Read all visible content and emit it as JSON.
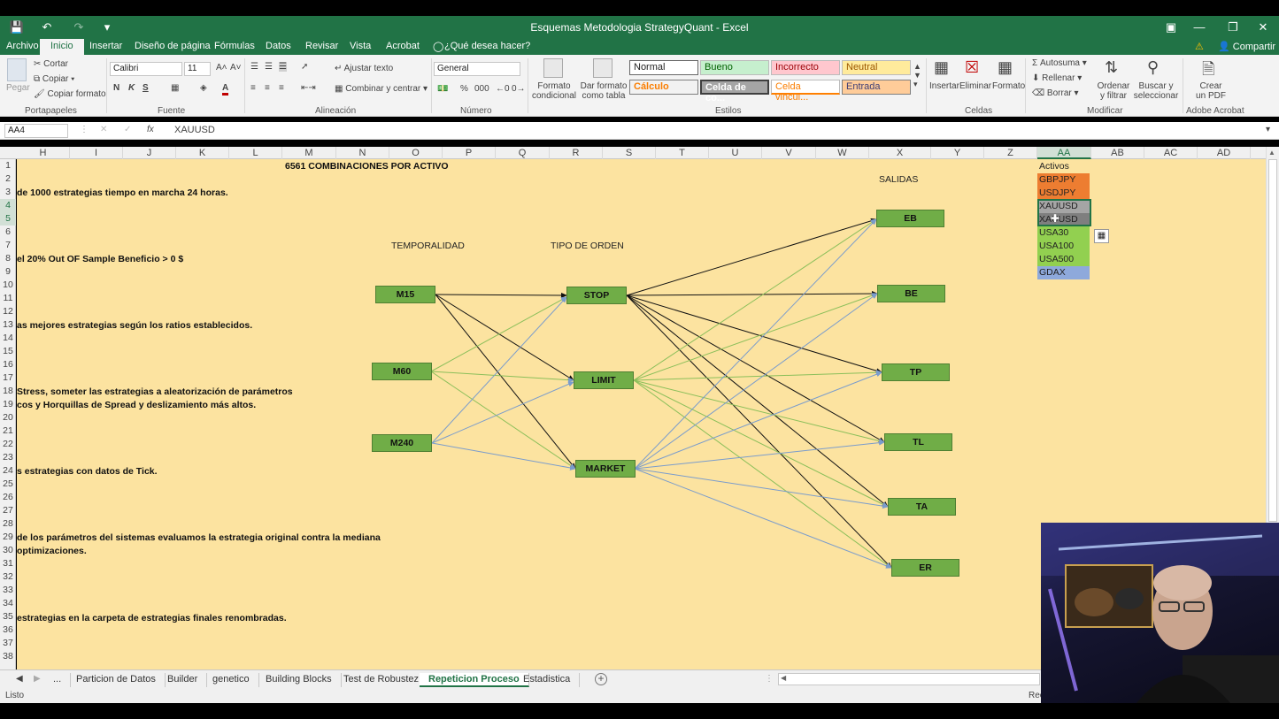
{
  "window": {
    "title": "Esquemas Metodologia StrategyQuant - Excel"
  },
  "ribbon_tabs": [
    "Archivo",
    "Inicio",
    "Insertar",
    "Diseño de página",
    "Fórmulas",
    "Datos",
    "Revisar",
    "Vista",
    "Acrobat"
  ],
  "tell_me": "¿Qué desea hacer?",
  "share_label": "Compartir",
  "clipboard": {
    "paste": "Pegar",
    "cut": "Cortar",
    "copy": "Copiar",
    "format_painter": "Copiar formato",
    "group": "Portapapeles"
  },
  "font": {
    "name": "Calibri",
    "size": "11",
    "group": "Fuente"
  },
  "alignment": {
    "wrap": "Ajustar texto",
    "merge": "Combinar y centrar",
    "group": "Alineación"
  },
  "number": {
    "format": "General",
    "group": "Número"
  },
  "styles": {
    "conditional": "Formato condicional",
    "as_table": "Dar formato como tabla",
    "items": [
      "Normal",
      "Bueno",
      "Incorrecto",
      "Neutral",
      "Cálculo",
      "Celda de co...",
      "Celda vincul...",
      "Entrada"
    ],
    "group": "Estilos"
  },
  "cells": {
    "insert": "Insertar",
    "delete": "Eliminar",
    "format": "Formato",
    "group": "Celdas"
  },
  "editing": {
    "autosum": "Autosuma",
    "fill": "Rellenar",
    "clear": "Borrar",
    "sort": "Ordenar y filtrar",
    "find": "Buscar y seleccionar",
    "group": "Modificar"
  },
  "acrobat": {
    "create_pdf": "Crear un PDF",
    "group": "Adobe Acrobat"
  },
  "formula_bar": {
    "name_box": "AA4",
    "value": "XAUUSD"
  },
  "columns": [
    "H",
    "I",
    "J",
    "K",
    "L",
    "M",
    "N",
    "O",
    "P",
    "Q",
    "R",
    "S",
    "T",
    "U",
    "V",
    "W",
    "X",
    "Y",
    "Z",
    "AA",
    "AB",
    "AC",
    "AD"
  ],
  "rows": [
    "1",
    "2",
    "3",
    "4",
    "5",
    "6",
    "7",
    "8",
    "9",
    "10",
    "11",
    "12",
    "13",
    "14",
    "15",
    "16",
    "17",
    "18",
    "19",
    "20",
    "21",
    "22",
    "23",
    "24",
    "25",
    "26",
    "27",
    "28",
    "29",
    "30",
    "31",
    "32",
    "33",
    "34",
    "35",
    "36",
    "37",
    "38"
  ],
  "sheet_text": {
    "r1": "6561 COMBINACIONES POR ACTIVO",
    "r3": "de 1000 estrategias tiempo en marcha 24 horas.",
    "r8": "el 20% Out OF Sample Beneficio > 0 $",
    "r13": "as mejores estrategias según los ratios establecidos.",
    "r18": "Stress, someter las estrategias a aleatorización de parámetros",
    "r19": "cos y Horquillas de Spread y deslizamiento más altos.",
    "r24": "s estrategias con datos de Tick.",
    "r29": "de los parámetros del sistemas evaluamos la estrategia original contra la mediana",
    "r30": "optimizaciones.",
    "r35": "estrategias en la carpeta de estrategias finales renombradas."
  },
  "diagram": {
    "timeframe_label": "TEMPORALIDAD",
    "order_label": "TIPO DE ORDEN",
    "exits_label": "SALIDAS",
    "timeframes": [
      "M15",
      "M60",
      "M240"
    ],
    "orders": [
      "STOP",
      "LIMIT",
      "MARKET"
    ],
    "exits": [
      "EB",
      "BE",
      "TP",
      "TL",
      "TA",
      "ER"
    ]
  },
  "assets": {
    "header": "Activos",
    "items": [
      {
        "name": "GBPJPY",
        "color": "#ed7d31"
      },
      {
        "name": "USDJPY",
        "color": "#ed7d31"
      },
      {
        "name": "XAUUSD",
        "color": "#a5a5a5"
      },
      {
        "name": "XAUUSD",
        "color": "#a5a5a5"
      },
      {
        "name": "USA30",
        "color": "#92d050"
      },
      {
        "name": "USA100",
        "color": "#92d050"
      },
      {
        "name": "USA500",
        "color": "#92d050"
      },
      {
        "name": "GDAX",
        "color": "#8ea9db"
      }
    ]
  },
  "sheet_tabs": [
    "...",
    "Particion de Datos",
    "Builder",
    "genetico",
    "Building Blocks",
    "Test de Robustez",
    "Repeticion Proceso",
    "Estadistica"
  ],
  "active_sheet": "Repeticion Proceso",
  "status": {
    "left": "Listo",
    "right": "Rec"
  },
  "colors": {
    "excel_green": "#217346",
    "sheet_fill": "#fce3a0",
    "node_green": "#70ad47"
  }
}
